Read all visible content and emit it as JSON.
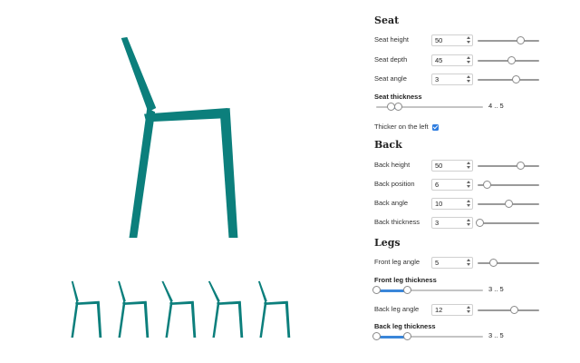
{
  "colors": {
    "chair": "#0c7f7c",
    "accent": "#3a86d9"
  },
  "seat": {
    "title": "Seat",
    "height": {
      "label": "Seat height",
      "value": "50",
      "level": 0.7
    },
    "depth": {
      "label": "Seat depth",
      "value": "45",
      "level": 0.55
    },
    "angle": {
      "label": "Seat angle",
      "value": "3",
      "level": 0.62
    },
    "thickness": {
      "label": "Seat thickness",
      "min": "4",
      "max": "5",
      "range_text": "4 .. 5",
      "low_level": 0.14,
      "high_level": 0.21
    },
    "thicker_left": {
      "label": "Thicker on the left",
      "checked": true
    }
  },
  "back": {
    "title": "Back",
    "height": {
      "label": "Back height",
      "value": "50",
      "level": 0.7
    },
    "position": {
      "label": "Back position",
      "value": "6",
      "level": 0.15
    },
    "angle": {
      "label": "Back angle",
      "value": "10",
      "level": 0.5
    },
    "thickness": {
      "label": "Back thickness",
      "value": "3",
      "level": 0.03
    }
  },
  "legs": {
    "title": "Legs",
    "front_angle": {
      "label": "Front leg angle",
      "value": "5",
      "level": 0.25
    },
    "front_thickness": {
      "label": "Front leg thickness",
      "min": "3",
      "max": "5",
      "range_text": "3 .. 5",
      "low_level": 0.0,
      "high_level": 0.29
    },
    "back_angle": {
      "label": "Back leg angle",
      "value": "12",
      "level": 0.6
    },
    "back_thickness": {
      "label": "Back leg thickness",
      "min": "3",
      "max": "5",
      "range_text": "3 .. 5",
      "low_level": 0.0,
      "high_level": 0.29
    }
  },
  "preview": {
    "main": {
      "back_lean": 0.13,
      "seat_tilt": 0.06
    },
    "thumbnails": [
      {
        "back_lean": 0.04,
        "seat_tilt": 0.02
      },
      {
        "back_lean": 0.06,
        "seat_tilt": 0.04
      },
      {
        "back_lean": 0.18,
        "seat_tilt": 0.08
      },
      {
        "back_lean": 0.2,
        "seat_tilt": 0.1
      },
      {
        "back_lean": 0.1,
        "seat_tilt": 0.05
      }
    ]
  }
}
